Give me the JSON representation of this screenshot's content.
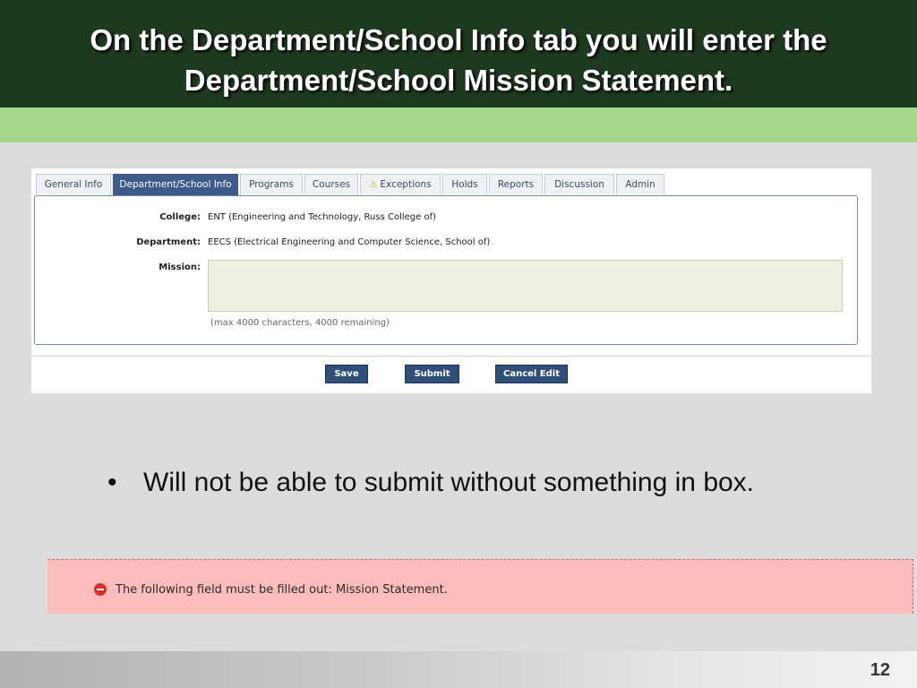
{
  "slide": {
    "title": "On the Department/School Info tab you will enter the Department/School Mission Statement.",
    "bullet": "Will not be able to submit without something in box.",
    "page_number": "12",
    "colors": {
      "title_band": "#1e3a1e",
      "accent_band": "#a4d78b",
      "background": "#dcdcdc"
    }
  },
  "screenshot": {
    "tabs": [
      {
        "label": "General Info",
        "active": false
      },
      {
        "label": "Department/School Info",
        "active": true
      },
      {
        "label": "Programs",
        "active": false
      },
      {
        "label": "Courses",
        "active": false
      },
      {
        "label": "Exceptions",
        "active": false,
        "icon": "warning-icon"
      },
      {
        "label": "Holds",
        "active": false
      },
      {
        "label": "Reports",
        "active": false
      },
      {
        "label": "Discussion",
        "active": false
      },
      {
        "label": "Admin",
        "active": false
      }
    ],
    "form": {
      "college_label": "College:",
      "college_value": "ENT (Engineering and Technology, Russ College of)",
      "department_label": "Department:",
      "department_value": "EECS (Electrical Engineering and Computer Science, School of)",
      "mission_label": "Mission:",
      "mission_value": "",
      "mission_hint": "(max 4000 characters, 4000 remaining)"
    },
    "buttons": {
      "save": "Save",
      "submit": "Submit",
      "cancel": "Cancel Edit"
    },
    "colors": {
      "active_tab": "#3d5a8a",
      "button": "#2f4f7a"
    }
  },
  "error": {
    "icon": "error-icon",
    "message": "The following field must be filled out: Mission Statement.",
    "colors": {
      "background": "#fcbcbc",
      "icon": "#d9312a"
    }
  }
}
